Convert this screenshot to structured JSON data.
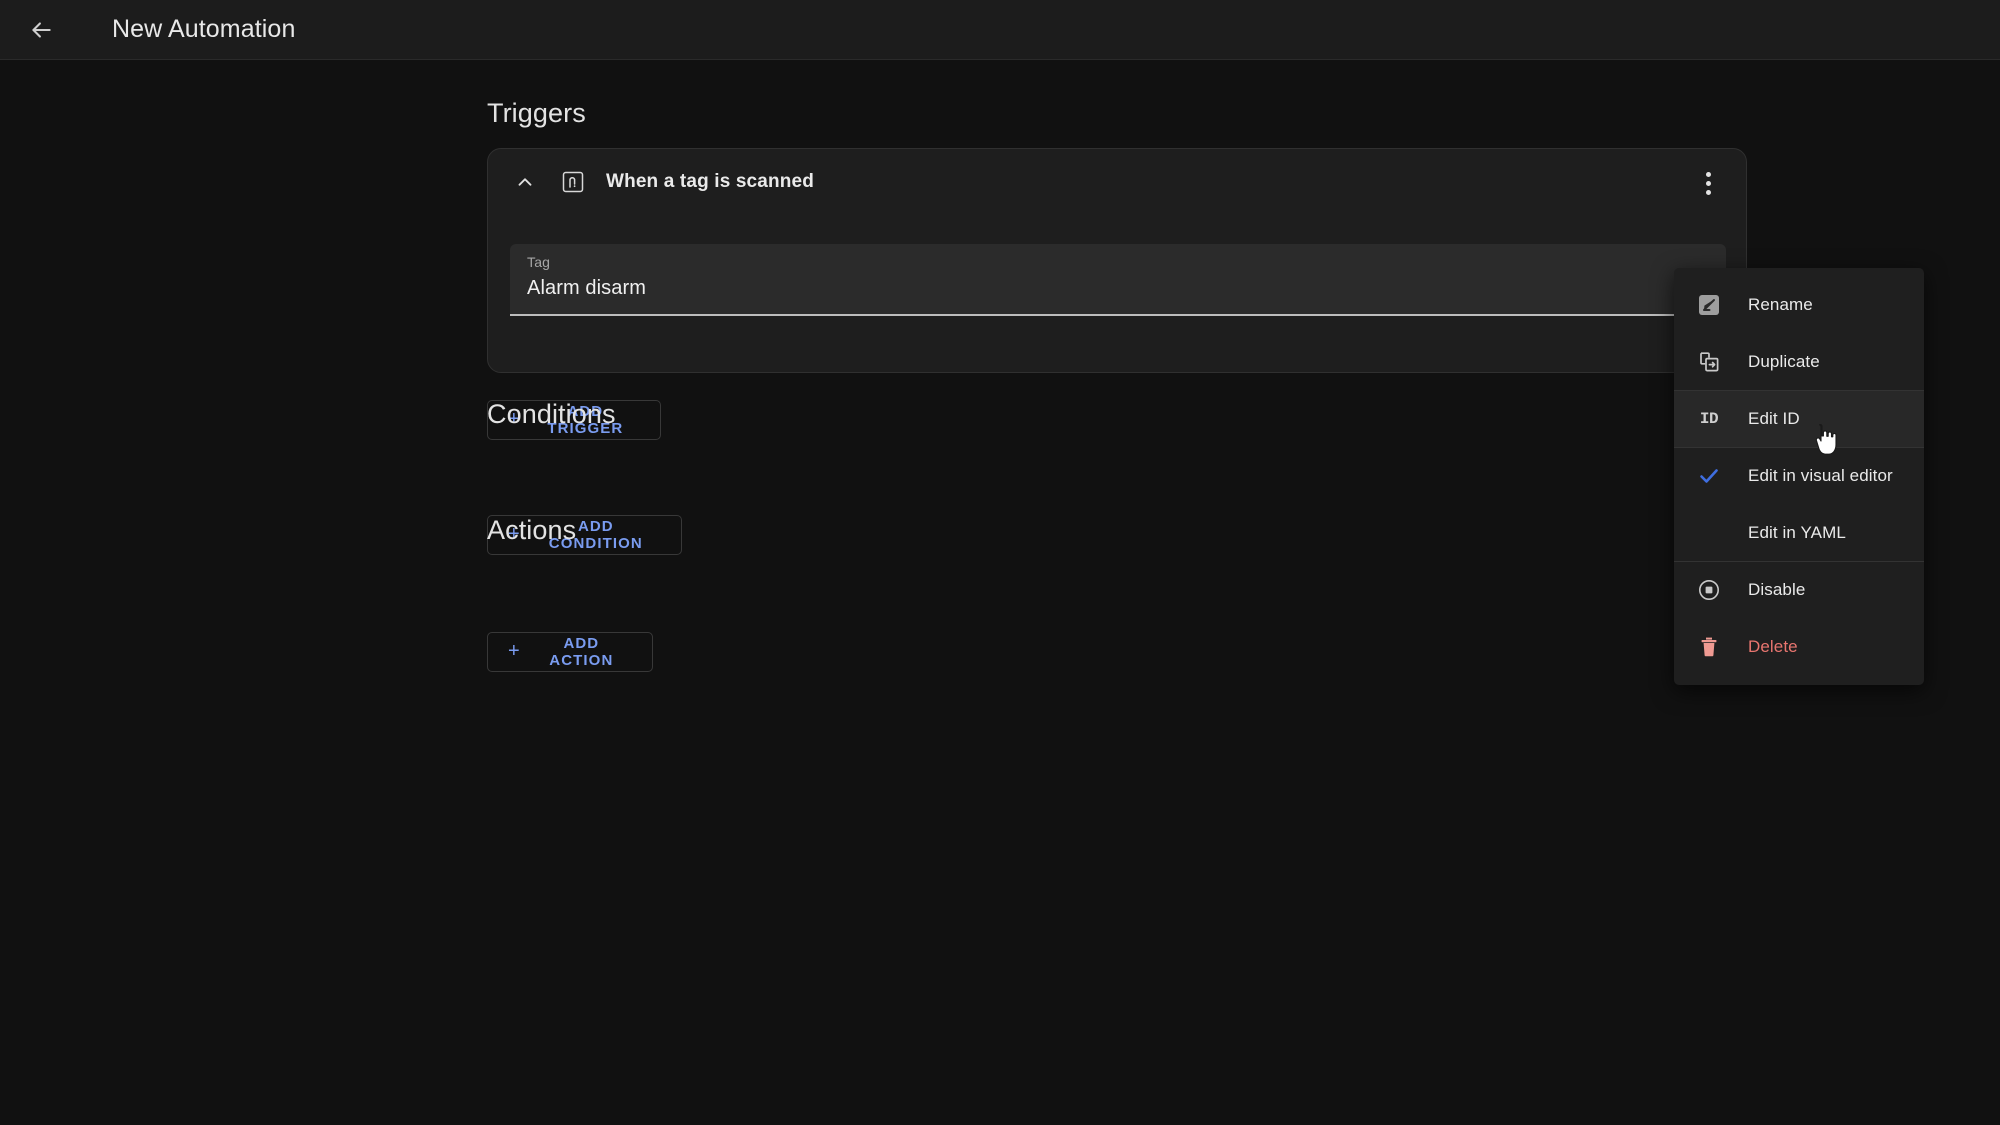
{
  "topbar": {
    "back_icon": "arrow-left-icon",
    "title": "New Automation"
  },
  "page": {
    "help_icon_label": "?",
    "background_color": "#111111",
    "accent_color": "#7a9cf0",
    "danger_color": "#e8756f"
  },
  "sections": {
    "triggers": {
      "heading": "Triggers",
      "add_button": {
        "label": "ADD TRIGGER",
        "plus": "+"
      }
    },
    "conditions": {
      "heading": "Conditions",
      "add_button": {
        "label": "ADD CONDITION",
        "plus": "+"
      }
    },
    "actions": {
      "heading": "Actions",
      "add_button": {
        "label": "ADD ACTION",
        "plus": "+"
      }
    }
  },
  "trigger_card": {
    "collapse_icon": "chevron-up-icon",
    "type_icon": "nfc-tag-icon",
    "title": "When a tag is scanned",
    "overflow_icon": "more-vertical-icon",
    "field": {
      "label": "Tag",
      "value": "Alarm disarm"
    }
  },
  "context_menu": {
    "items": [
      {
        "label": "Rename",
        "icon": "rename-pencil-icon",
        "divider_top": false,
        "highlight": false,
        "danger": false
      },
      {
        "label": "Duplicate",
        "icon": "duplicate-icon",
        "divider_top": false,
        "highlight": false,
        "danger": false
      },
      {
        "label": "Edit ID",
        "icon": "id-icon",
        "divider_top": true,
        "highlight": true,
        "danger": false
      },
      {
        "label": "Edit in visual editor",
        "icon": "check-icon",
        "divider_top": true,
        "highlight": false,
        "danger": false
      },
      {
        "label": "Edit in YAML",
        "icon": "none",
        "divider_top": false,
        "highlight": false,
        "danger": false
      },
      {
        "label": "Disable",
        "icon": "stop-circle-icon",
        "divider_top": true,
        "highlight": false,
        "danger": false
      },
      {
        "label": "Delete",
        "icon": "trash-icon",
        "divider_top": false,
        "highlight": false,
        "danger": true
      }
    ]
  }
}
